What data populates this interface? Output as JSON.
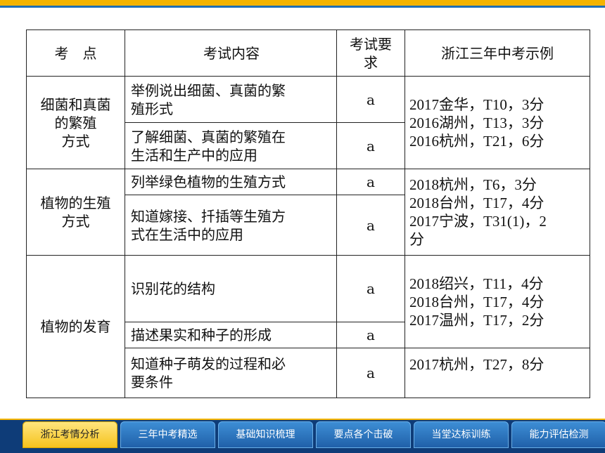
{
  "header": {
    "col1": "考　点",
    "col2": "考试内容",
    "col3_line1": "考试要",
    "col3_line2": "求",
    "col4": "浙江三年中考示例"
  },
  "sections": [
    {
      "topic_lines": [
        "细菌和真菌",
        "的繁殖",
        "方式"
      ],
      "examples": [
        "2017金华，T10，3分",
        "2016湖州，T13，3分",
        "2016杭州，T21，6分"
      ],
      "items": [
        {
          "content_lines": [
            "举例说出细菌、真菌的繁",
            "殖形式"
          ],
          "requirement": "a"
        },
        {
          "content_lines": [
            "了解细菌、真菌的繁殖在",
            "生活和生产中的应用"
          ],
          "requirement": "a"
        }
      ]
    },
    {
      "topic_lines": [
        "植物的生殖",
        "方式"
      ],
      "examples": [
        "2018杭州，T6，3分",
        "2018台州，T17，4分",
        "2017宁波，T31(1)，2",
        "分"
      ],
      "items": [
        {
          "content_lines": [
            "列举绿色植物的生殖方式"
          ],
          "requirement": "a"
        },
        {
          "content_lines": [
            "知道嫁接、扦插等生殖方",
            "式在生活中的应用"
          ],
          "requirement": "a"
        }
      ]
    },
    {
      "topic_lines": [
        "植物的发育"
      ],
      "examples_a": [
        "2018绍兴，T11，4分",
        "2018台州，T17，4分",
        "2017温州，T17，2分"
      ],
      "examples_b": [
        "2017杭州，T27，8分"
      ],
      "items": [
        {
          "content_lines": [
            "识别花的结构"
          ],
          "requirement": "a"
        },
        {
          "content_lines": [
            "描述果实和种子的形成"
          ],
          "requirement": "a"
        },
        {
          "content_lines": [
            "知道种子萌发的过程和必",
            "要条件"
          ],
          "requirement": "a"
        }
      ]
    }
  ],
  "nav": {
    "tabs": [
      "浙江考情分析",
      "三年中考精选",
      "基础知识梳理",
      "要点各个击破",
      "当堂达标训练",
      "能力评估检测"
    ],
    "active_index": 0
  },
  "colors": {
    "top_bar": "#f4b400",
    "accent_blue": "#1f6fb5",
    "bottom_band": "#0e3c78",
    "active_tab": "#f5c21b"
  }
}
